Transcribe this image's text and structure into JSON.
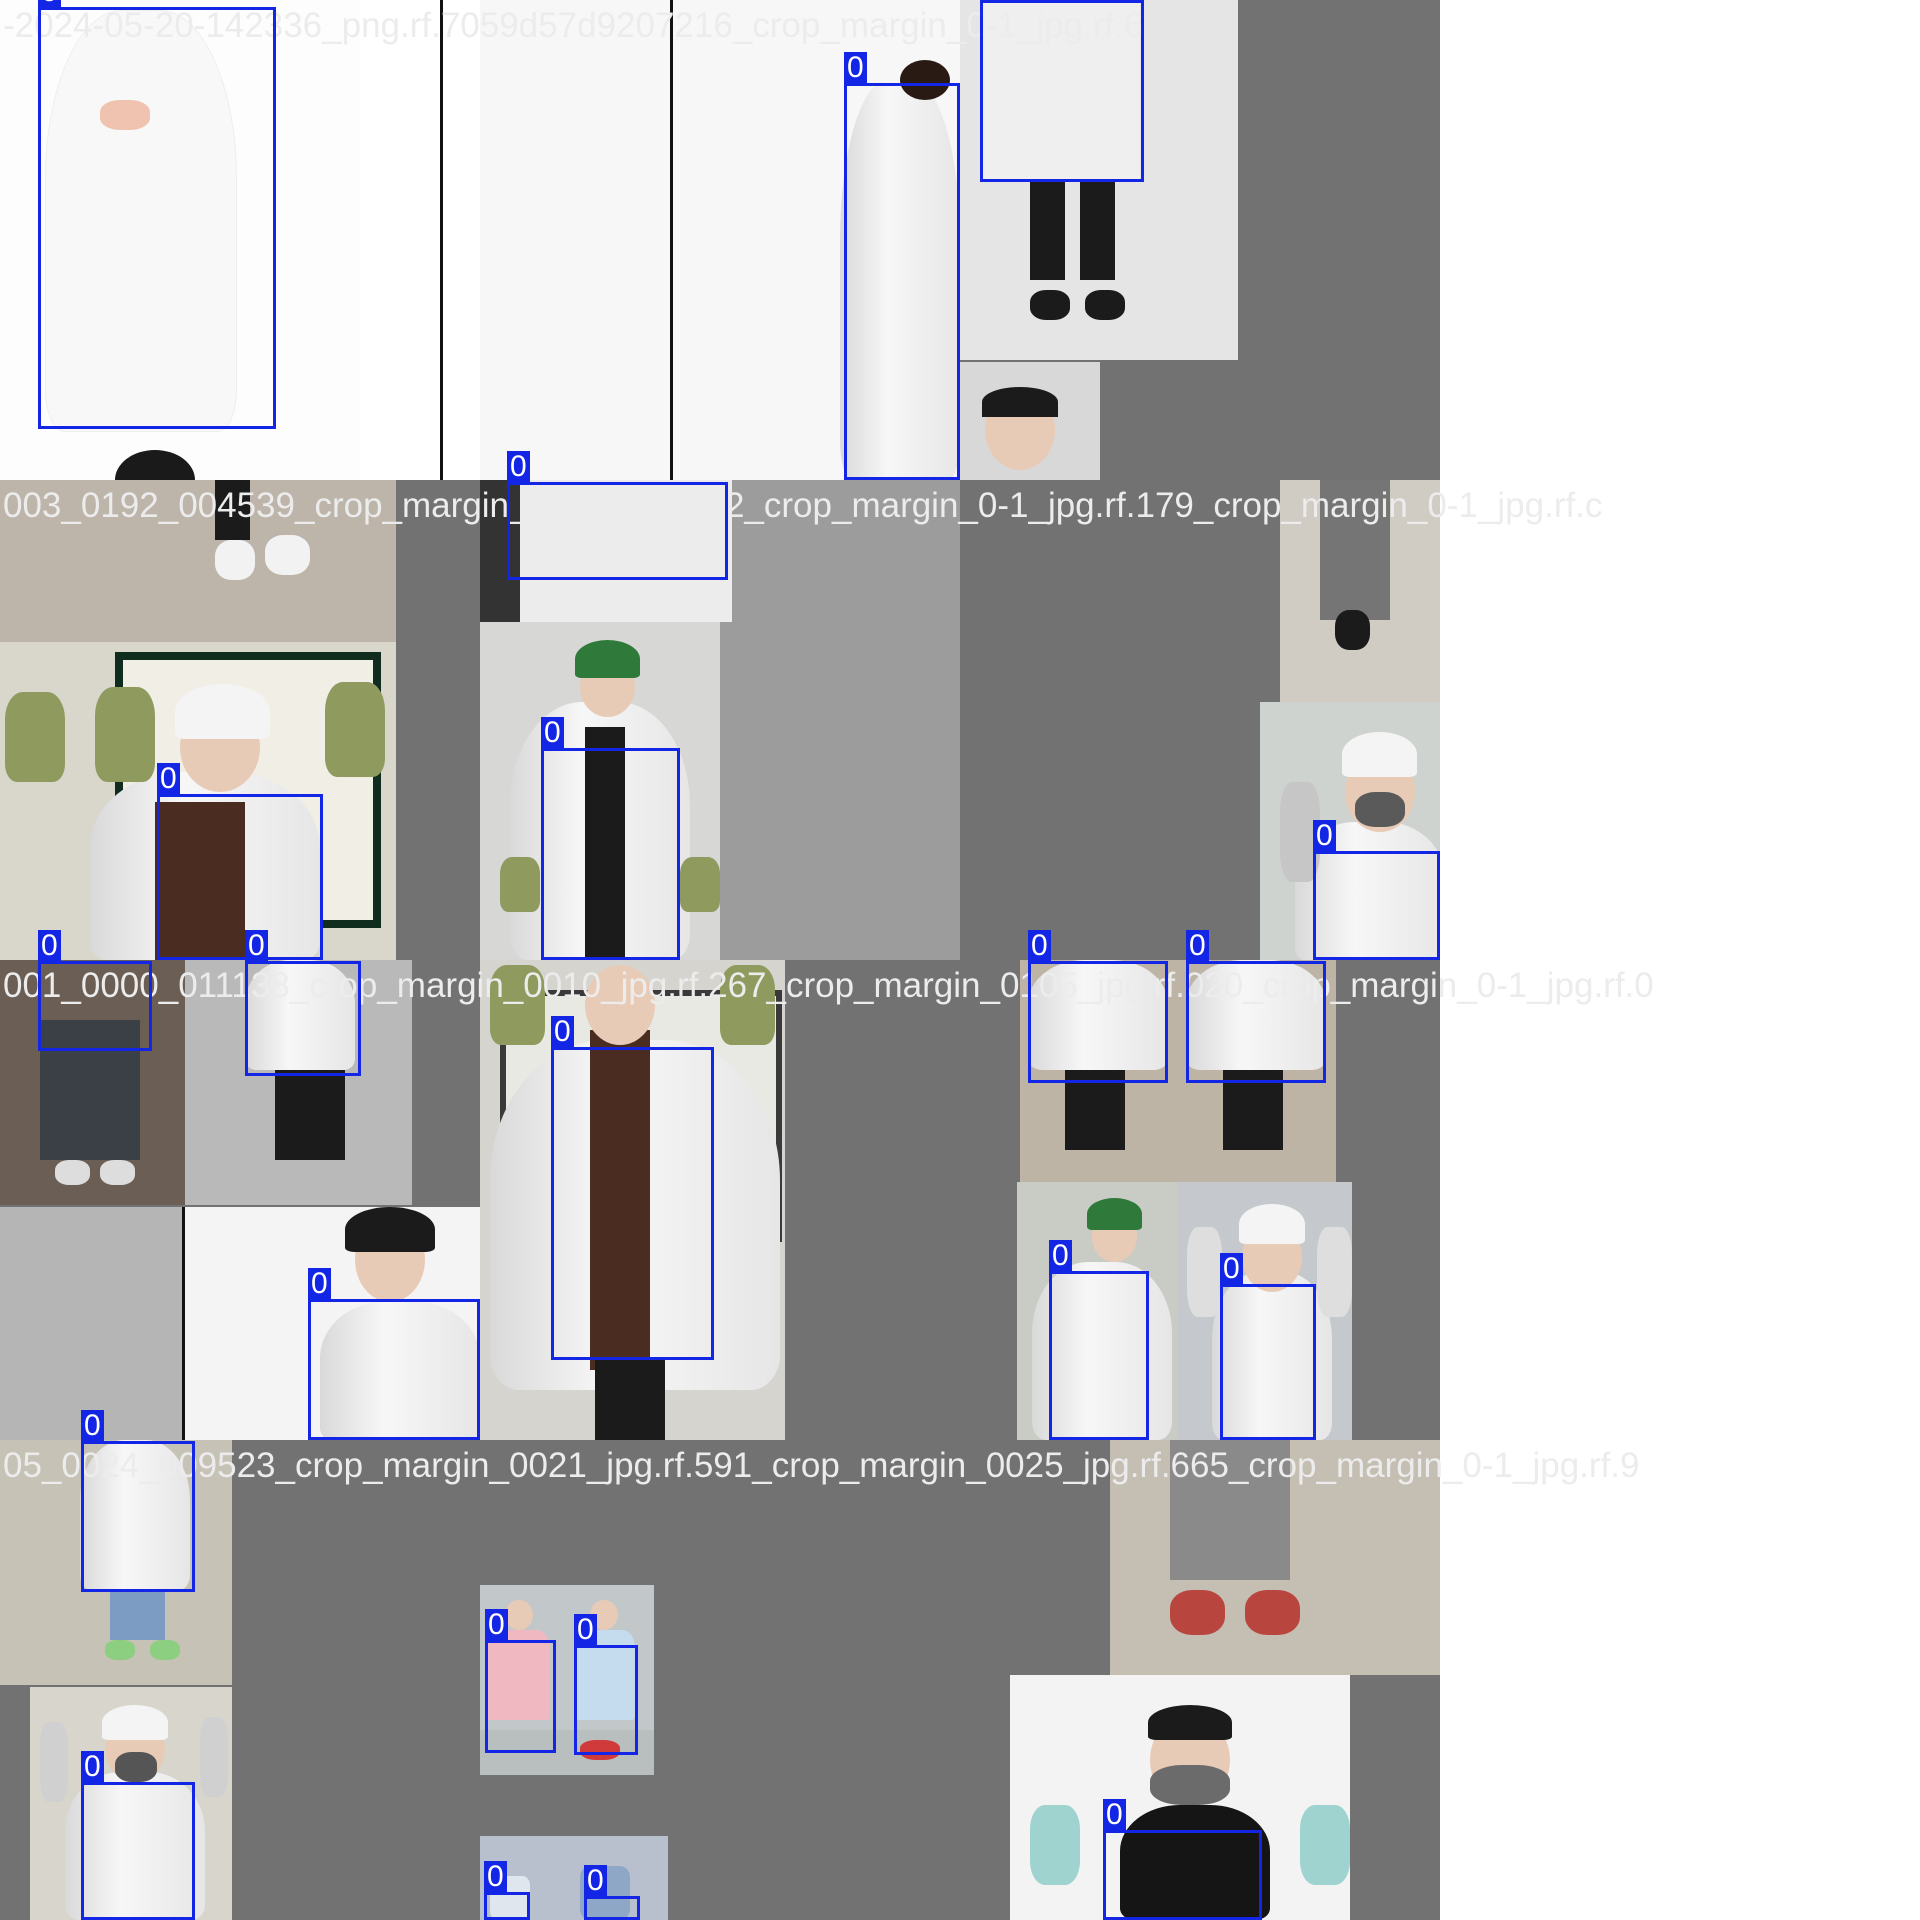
{
  "mosaic": {
    "class_label": "0",
    "box_color": "#1326e6",
    "fill_gray": "#727272",
    "tiles": [
      {
        "title": "-2024-05-20-142336_png.rf.7059d57d9207216_crop_margin_0-1_jpg.rf.6"
      },
      {
        "title": "003_0192_004539_crop_margin_0-1_jpg.rf.662_crop_margin_0-1_jpg.rf.179_crop_margin_0-1_jpg.rf.c"
      },
      {
        "title": "001_0000_011138_crop_margin_0010_jpg.rf.267_crop_margin_0105_jpg.rf.020_crop_margin_0-1_jpg.rf.0"
      },
      {
        "title": "05_0024_009523_crop_margin_0021_jpg.rf.591_crop_margin_0025_jpg.rf.665_crop_margin_0-1_jpg.rf.9"
      }
    ]
  }
}
